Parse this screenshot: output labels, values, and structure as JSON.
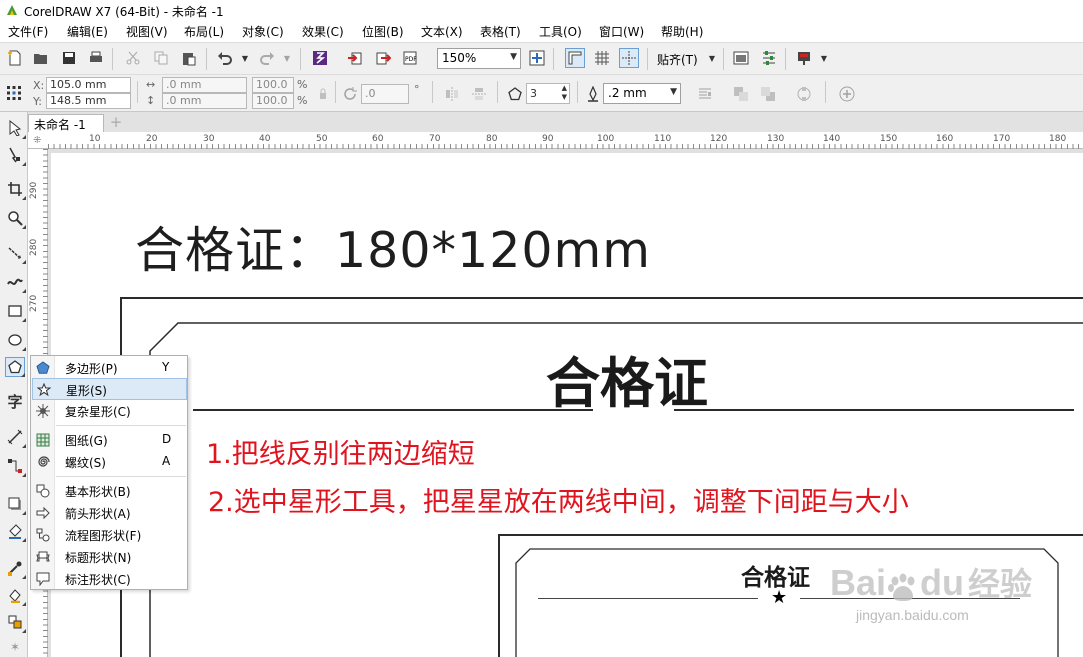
{
  "window": {
    "title": "CorelDRAW X7 (64-Bit) - 未命名 -1"
  },
  "menu": [
    "文件(F)",
    "编辑(E)",
    "视图(V)",
    "布局(L)",
    "对象(C)",
    "效果(C)",
    "位图(B)",
    "文本(X)",
    "表格(T)",
    "工具(O)",
    "窗口(W)",
    "帮助(H)"
  ],
  "toolbar": {
    "zoom_value": "150%",
    "snap_label": "贴齐(T)"
  },
  "property_bar": {
    "x_label": "X:",
    "x_value": "105.0 mm",
    "y_label": "Y:",
    "y_value": "148.5 mm",
    "w_value": ".0 mm",
    "h_value": ".0 mm",
    "scale_x": "100.0",
    "scale_y": "100.0",
    "percent": "%",
    "angle_value": ".0",
    "angle_unit": "°",
    "points_value": "3",
    "outline_width": ".2 mm"
  },
  "document_tab": {
    "label": "未命名 -1",
    "add": "+"
  },
  "ruler_h": [
    "10",
    "20",
    "30",
    "40",
    "50",
    "60",
    "70",
    "80",
    "90",
    "100",
    "110",
    "120",
    "130",
    "140",
    "150",
    "160",
    "170",
    "180"
  ],
  "ruler_v": [
    "290",
    "280",
    "270"
  ],
  "canvas": {
    "heading": "合格证：180*120mm",
    "cert_title": "合格证",
    "instruction_1": "1.把线反别往两边缩短",
    "instruction_2": "2.选中星形工具，把星星放在两线中间，调整下间距与大小",
    "preview_title": "合格证",
    "preview_star": "★",
    "watermark_brand": "Bai",
    "watermark_brand2": "du",
    "watermark_cn": "经验",
    "watermark_url": "jingyan.baidu.com"
  },
  "flyout": {
    "items": [
      {
        "label": "多边形(P)",
        "key": "Y",
        "icon": "polygon-icon"
      },
      {
        "label": "星形(S)",
        "key": "",
        "icon": "star-icon",
        "selected": true
      },
      {
        "label": "复杂星形(C)",
        "key": "",
        "icon": "complex-star-icon"
      },
      {
        "label": "图纸(G)",
        "key": "D",
        "icon": "graph-paper-icon"
      },
      {
        "label": "螺纹(S)",
        "key": "A",
        "icon": "spiral-icon"
      },
      {
        "label": "基本形状(B)",
        "key": "",
        "icon": "basic-shapes-icon"
      },
      {
        "label": "箭头形状(A)",
        "key": "",
        "icon": "arrow-shapes-icon"
      },
      {
        "label": "流程图形状(F)",
        "key": "",
        "icon": "flowchart-shapes-icon"
      },
      {
        "label": "标题形状(N)",
        "key": "",
        "icon": "banner-shapes-icon"
      },
      {
        "label": "标注形状(C)",
        "key": "",
        "icon": "callout-shapes-icon"
      }
    ]
  },
  "toolbox": {
    "text_tool_glyph": "字"
  },
  "colors": {
    "instruction": "#e0141e",
    "selection": "#dceaf7",
    "chrome": "#f0f0f0"
  }
}
